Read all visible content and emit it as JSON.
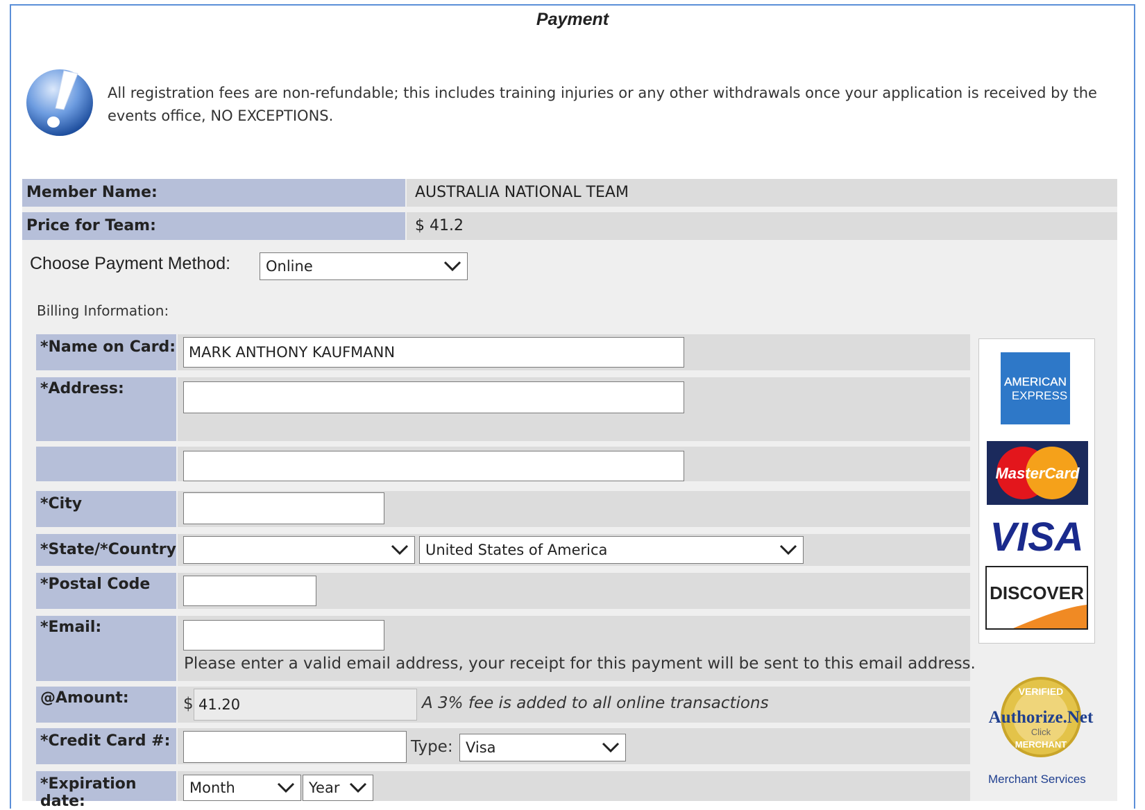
{
  "page": {
    "title": "Payment"
  },
  "notice": {
    "text": "All registration fees are non-refundable; this includes training injuries or any other withdrawals once your application is received by the events office, NO EXCEPTIONS."
  },
  "summary": {
    "member_label": "Member Name:",
    "member_value": "AUSTRALIA NATIONAL TEAM",
    "price_label": "Price for Team:",
    "price_value": "$ 41.2"
  },
  "payment_method": {
    "label": "Choose Payment Method:",
    "selected": "Online"
  },
  "billing": {
    "section_label": "Billing Information:",
    "name_label": "*Name on Card:",
    "name_value": "MARK ANTHONY KAUFMANN",
    "address_label": "*Address:",
    "address_value": "",
    "address2_value": "",
    "city_label": "*City",
    "city_value": "",
    "state_country_label": "*State/*Country:",
    "state_value": "",
    "country_value": "United States of America",
    "postal_label": "*Postal Code",
    "postal_value": "",
    "email_label": "*Email:",
    "email_value": "",
    "email_hint": "Please enter a valid email address, your receipt for this payment will be sent to this email address.",
    "amount_label": "@Amount:",
    "amount_currency": "$",
    "amount_value": "41.20",
    "amount_note": "A 3% fee is added to all online transactions",
    "cc_label": "*Credit Card #:",
    "cc_value": "",
    "type_label": "Type:",
    "type_value": "Visa",
    "exp_label": "*Expiration date:",
    "exp_month": "Month",
    "exp_year": "Year"
  },
  "cards": {
    "amex_line1": "AMERICAN",
    "amex_line2": "EXPRESS",
    "mastercard": "MasterCard",
    "visa": "VISA",
    "discover": "DISCOVER"
  },
  "seal": {
    "top": "VERIFIED",
    "brand": "Authorize.Net",
    "click": "Click",
    "bottom": "MERCHANT",
    "caption": "Merchant Services"
  },
  "colors": {
    "label_bg": "#b6bfd9",
    "value_bg": "#dcdcdc",
    "frame_border": "#5b8fd8"
  }
}
